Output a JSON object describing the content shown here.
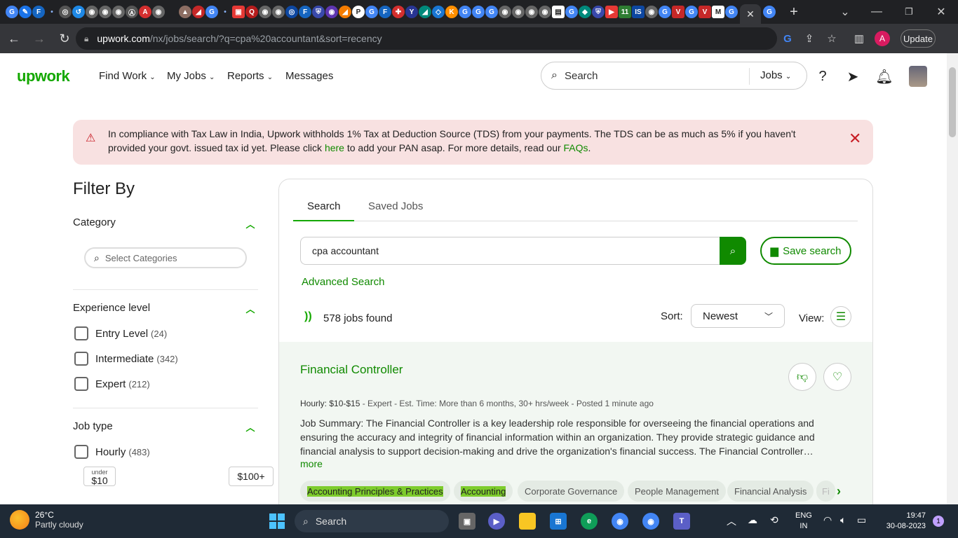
{
  "browser": {
    "url_host": "upwork.com",
    "url_path": "/nx/jobs/search/?q=cpa%20accountant&sort=recency",
    "update_label": "Update",
    "profile_initial": "A"
  },
  "nav": {
    "logo": "upwork",
    "find_work": "Find Work",
    "my_jobs": "My Jobs",
    "reports": "Reports",
    "messages": "Messages",
    "search_placeholder": "Search",
    "search_scope": "Jobs"
  },
  "alert": {
    "text_before": "In compliance with Tax Law in India, Upwork withholds 1% Tax at Deduction Source (TDS) from your payments. The TDS can be as much as 5% if you haven't provided your govt. issued tax id yet. Please click ",
    "link_here": "here",
    "text_middle": " to add your PAN asap. For more details, read our ",
    "link_faqs": "FAQs",
    "text_end": "."
  },
  "filters": {
    "title": "Filter By",
    "category": "Category",
    "category_placeholder": "Select Categories",
    "experience": "Experience level",
    "exp_items": [
      {
        "label": "Entry Level",
        "count": "(24)"
      },
      {
        "label": "Intermediate",
        "count": "(342)"
      },
      {
        "label": "Expert",
        "count": "(212)"
      }
    ],
    "job_type": "Job type",
    "hourly_label": "Hourly",
    "hourly_count": "(483)",
    "min_small": "under",
    "min_price": "$10",
    "max_price": "$100+"
  },
  "results": {
    "tab_search": "Search",
    "tab_saved": "Saved Jobs",
    "query": "cpa accountant",
    "save_search": "Save search",
    "advanced": "Advanced Search",
    "count_num": "578",
    "count_text": "jobs found",
    "sort_label": "Sort:",
    "sort_value": "Newest",
    "view_label": "View:"
  },
  "job": {
    "title": "Financial Controller",
    "meta_rate": "Hourly: $10-$15",
    "meta_rest": " - Expert - Est. Time: More than 6 months, 30+ hrs/week - Posted ",
    "meta_posted": "1 minute ago",
    "description": "Job Summary: The Financial Controller is a key leadership role responsible for overseeing the financial operations and ensuring the accuracy and integrity of financial information within an organization. They provide strategic guidance and financial analysis to support decision-making and drive the organization's financial success. The Financial Controller…",
    "more": "more",
    "skills": [
      "Accounting Principles & Practices",
      "Accounting",
      "Corporate Governance",
      "People Management",
      "Financial Analysis",
      "Fi"
    ]
  },
  "taskbar": {
    "temp": "26°C",
    "weather": "Partly cloudy",
    "search": "Search",
    "lang1": "ENG",
    "lang2": "IN",
    "time": "19:47",
    "date": "30-08-2023",
    "notif_count": "1"
  }
}
